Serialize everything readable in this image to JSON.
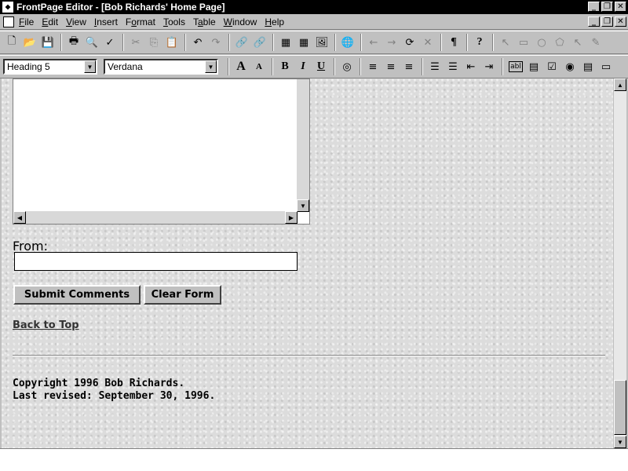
{
  "window": {
    "title": "FrontPage Editor - [Bob Richards' Home Page]"
  },
  "menu": [
    {
      "pre": "",
      "key": "F",
      "post": "ile"
    },
    {
      "pre": "",
      "key": "E",
      "post": "dit"
    },
    {
      "pre": "",
      "key": "V",
      "post": "iew"
    },
    {
      "pre": "",
      "key": "I",
      "post": "nsert"
    },
    {
      "pre": "F",
      "key": "o",
      "post": "rmat"
    },
    {
      "pre": "",
      "key": "T",
      "post": "ools"
    },
    {
      "pre": "T",
      "key": "a",
      "post": "ble"
    },
    {
      "pre": "",
      "key": "W",
      "post": "indow"
    },
    {
      "pre": "",
      "key": "H",
      "post": "elp"
    }
  ],
  "format_bar": {
    "style": "Heading 5",
    "font": "Verdana"
  },
  "toolbar_glyphs": {
    "new": "🗋",
    "open": "📂",
    "save": "💾",
    "print": "🖶",
    "preview": "🔍",
    "spell": "✓",
    "cut": "✂",
    "copy": "⎘",
    "paste": "📋",
    "undo": "↶",
    "redo": "↷",
    "link": "🔗",
    "table": "▦",
    "image": "🖼",
    "web": "🌐",
    "back": "←",
    "forward": "→",
    "refresh": "⟳",
    "stop": "✕",
    "pilcrow": "¶",
    "help": "?",
    "pointer": "↖",
    "rect": "▭",
    "circle": "○",
    "poly": "⬠",
    "pen": "✎",
    "grow": "A",
    "shrink": "A",
    "bold": "B",
    "italic": "I",
    "underline": "U",
    "color": "◎",
    "alignl": "≡",
    "alignc": "≡",
    "alignr": "≡",
    "numlist": "☰",
    "bullet": "☰",
    "outdent": "⇤",
    "indent": "⇥",
    "textbox": "abl",
    "scroll": "▤",
    "checkbox": "☑",
    "radio": "◉",
    "dropdown": "▤",
    "pushbtn": "▭"
  },
  "form": {
    "from_label": "From:",
    "from_value": "",
    "submit_label": "Submit Comments",
    "clear_label": "Clear Form"
  },
  "back_to_top": "Back to Top",
  "footer": {
    "copyright": "Copyright 1996 Bob Richards.",
    "revised": "Last revised: September 30, 1996."
  }
}
